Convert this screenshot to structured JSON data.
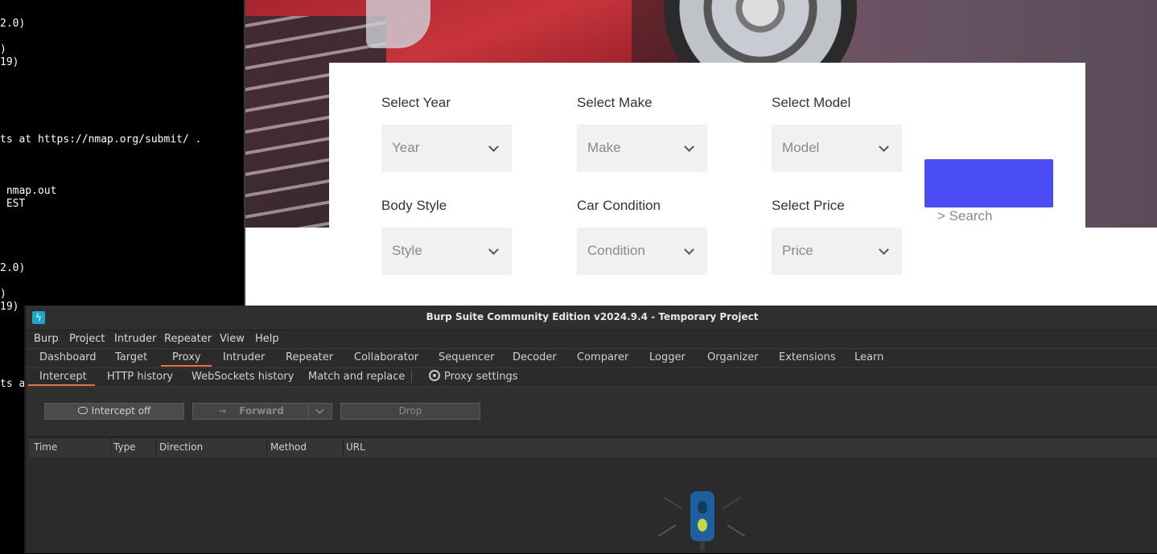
{
  "terminal": {
    "lines": [
      "2.0)",
      ")",
      "19)",
      "ts at https://nmap.org/submit/ .",
      " nmap.out",
      " EST",
      "2.0)",
      ")",
      "19)",
      "ts a"
    ]
  },
  "car_search": {
    "year_label": "Select Year",
    "year_placeholder": "Year",
    "make_label": "Select Make",
    "make_placeholder": "Make",
    "model_label": "Select Model",
    "model_placeholder": "Model",
    "style_label": "Body Style",
    "style_placeholder": "Style",
    "condition_label": "Car Condition",
    "condition_placeholder": "Condition",
    "price_label": "Select Price",
    "price_placeholder": "Price",
    "search_text": "> Search",
    "accent": "#4a4cf5"
  },
  "burp": {
    "title": "Burp Suite Community Edition v2024.9.4 - Temporary Project",
    "menu": [
      "Burp",
      "Project",
      "Intruder",
      "Repeater",
      "View",
      "Help"
    ],
    "tabs": [
      "Dashboard",
      "Target",
      "Proxy",
      "Intruder",
      "Repeater",
      "Collaborator",
      "Sequencer",
      "Decoder",
      "Comparer",
      "Logger",
      "Organizer",
      "Extensions",
      "Learn"
    ],
    "active_tab": "Proxy",
    "subtabs": [
      "Intercept",
      "HTTP history",
      "WebSockets history",
      "Match and replace"
    ],
    "active_subtab": "Intercept",
    "proxy_settings": "Proxy settings",
    "intercept_btn": "Intercept off",
    "forward_btn": "Forward",
    "drop_btn": "Drop",
    "columns": [
      "Time",
      "Type",
      "Direction",
      "Method",
      "URL"
    ],
    "accent": "#e8753a"
  }
}
